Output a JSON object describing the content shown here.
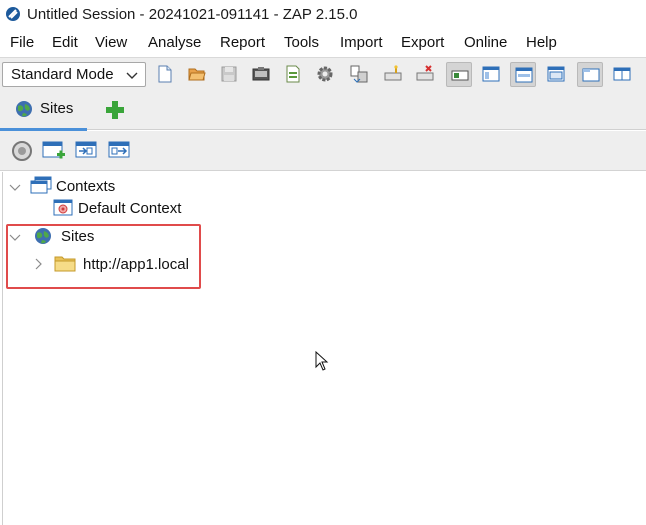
{
  "window": {
    "title": "Untitled Session - 20241021-091141 - ZAP 2.15.0"
  },
  "menu": [
    "File",
    "Edit",
    "View",
    "Analyse",
    "Report",
    "Tools",
    "Import",
    "Export",
    "Online",
    "Help"
  ],
  "toolbar": {
    "mode_value": "Standard Mode"
  },
  "tabs": {
    "sites_label": "Sites"
  },
  "tree": {
    "contexts_label": "Contexts",
    "default_context_label": "Default Context",
    "sites_label": "Sites",
    "site_url": "http://app1.local"
  },
  "colors": {
    "highlight": "#e04b4b",
    "tab_accent": "#4a90d9",
    "folder": "#f2d479"
  },
  "icons": [
    "zap-app-icon",
    "globe-icon",
    "add-tab-icon",
    "context-icon",
    "folder-icon"
  ]
}
